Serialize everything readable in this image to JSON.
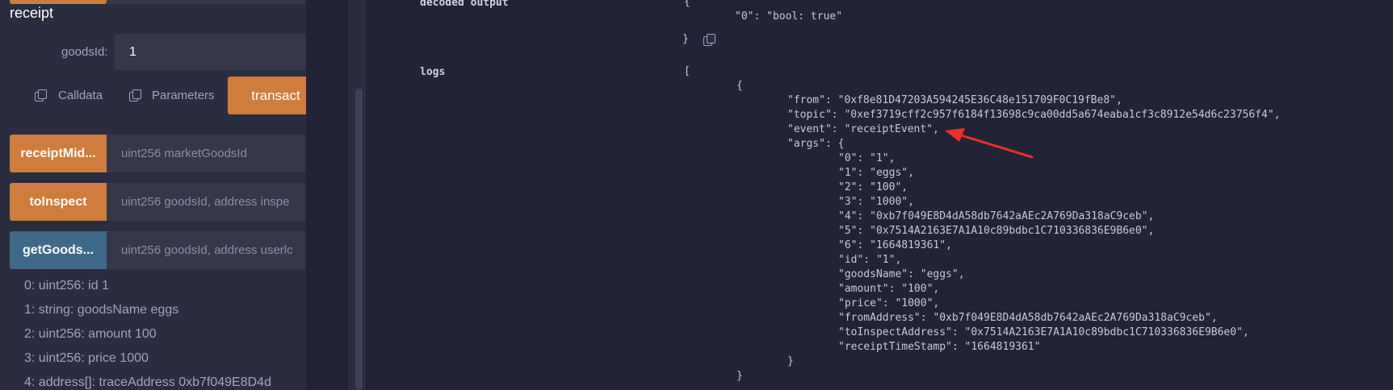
{
  "left": {
    "section_title": "receipt",
    "goods_id_label": "goodsId:",
    "goods_id_value": "1",
    "calldata_label": "Calldata",
    "parameters_label": "Parameters",
    "transact_label": "transact",
    "functions": [
      {
        "name": "receiptMid...",
        "placeholder": "uint256 marketGoodsId",
        "color": "#cf7c3c"
      },
      {
        "name": "toInspect",
        "placeholder": "uint256 goodsId, address inspe",
        "color": "#cf7c3c"
      },
      {
        "name": "getGoods...",
        "placeholder": "uint256 goodsId, address userlс",
        "color": "#3e6989"
      }
    ],
    "results": [
      "0: uint256: id 1",
      "1: string: goodsName eggs",
      "2: uint256: amount 100",
      "3: uint256: price 1000",
      "4:  address[]: traceAddress 0xb7f049E8D4d"
    ]
  },
  "right": {
    "decoded_output_label": "decoded output",
    "decoded_lines": [
      "{",
      "\"0\": \"bool: true\"",
      "}"
    ],
    "logs_label": "logs",
    "log_lines": [
      "[",
      "{",
      "\"from\": \"0xf8e81D47203A594245E36C48e151709F0C19fBe8\",",
      "\"topic\": \"0xef3719cff2c957f6184f13698c9ca00dd5a674eaba1cf3c8912e54d6c23756f4\",",
      "\"event\": \"receiptEvent\",",
      "\"args\": {",
      "\"0\": \"1\",",
      "\"1\": \"eggs\",",
      "\"2\": \"100\",",
      "\"3\": \"1000\",",
      "\"4\": \"0xb7f049E8D4dA58db7642aAEc2A769Da318aC9ceb\",",
      "\"5\": \"0x7514A2163E7A1A10c89bdbc1C710336836E9B6e0\",",
      "\"6\": \"1664819361\",",
      "\"id\": \"1\",",
      "\"goodsName\": \"eggs\",",
      "\"amount\": \"100\",",
      "\"price\": \"1000\",",
      "\"fromAddress\": \"0xb7f049E8D4dA58db7642aAEc2A769Da318aC9ceb\",",
      "\"toInspectAddress\": \"0x7514A2163E7A1A10c89bdbc1C710336836E9B6e0\",",
      "\"receiptTimeStamp\": \"1664819361\"",
      "}",
      "}"
    ]
  },
  "colors": {
    "accent_orange": "#cf7c3c",
    "accent_blue": "#3e6989",
    "annotation_arrow": "#e8312a"
  }
}
